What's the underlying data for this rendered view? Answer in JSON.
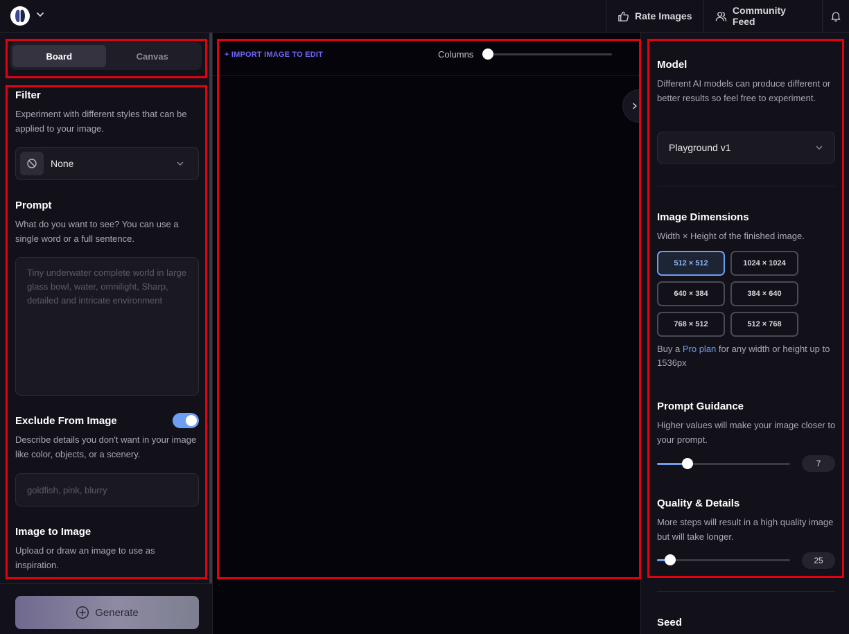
{
  "header": {
    "rate_label": "Rate Images",
    "feed_label": "Community Feed"
  },
  "left": {
    "tabs": [
      {
        "label": "Board",
        "active": true
      },
      {
        "label": "Canvas",
        "active": false
      }
    ],
    "filter": {
      "title": "Filter",
      "desc": "Experiment with different styles that can be applied to your image.",
      "value": "None"
    },
    "prompt": {
      "title": "Prompt",
      "desc": "What do you want to see? You can use a single word or a full sentence.",
      "placeholder": "Tiny underwater complete world in large glass bowl, water, omnilight, Sharp, detailed and intricate environment"
    },
    "exclude": {
      "title": "Exclude From Image",
      "desc": "Describe details you don't want in your image like color, objects, or a scenery.",
      "placeholder": "goldfish, pink, blurry",
      "enabled": true
    },
    "img2img": {
      "title": "Image to Image",
      "desc": "Upload or draw an image to use as inspiration."
    },
    "generate_label": "Generate"
  },
  "main": {
    "import_label": "+ IMPORT IMAGE TO EDIT",
    "columns_label": "Columns",
    "columns_value": 0
  },
  "right": {
    "model": {
      "title": "Model",
      "desc": "Different AI models can produce different or better results so feel free to experiment.",
      "value": "Playground v1"
    },
    "dimensions": {
      "title": "Image Dimensions",
      "desc": "Width × Height of the finished image.",
      "options": [
        "512 × 512",
        "1024 × 1024",
        "640 × 384",
        "384 × 640",
        "768 × 512",
        "512 × 768"
      ],
      "selected": "512 × 512",
      "pro_prefix": "Buy a ",
      "pro_link": "Pro plan",
      "pro_suffix": " for any width or height up to 1536px"
    },
    "guidance": {
      "title": "Prompt Guidance",
      "desc": "Higher values will make your image closer to your prompt.",
      "value": "7",
      "fraction": 0.23
    },
    "quality": {
      "title": "Quality & Details",
      "desc": "More steps will result in a high quality image but will take longer.",
      "value": "25",
      "fraction": 0.1
    },
    "seed": {
      "title": "Seed"
    }
  },
  "colors": {
    "accent": "#6e9ef0",
    "import_link": "#6f68f5",
    "annotation": "#e3000f"
  }
}
